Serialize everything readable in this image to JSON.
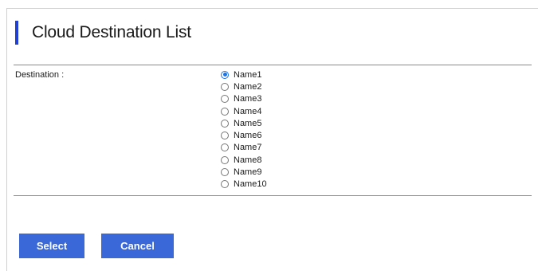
{
  "page": {
    "title": "Cloud Destination List",
    "accent_color": "#1f3fd6"
  },
  "form": {
    "destination_label": "Destination :",
    "selected_index": 0,
    "options": [
      {
        "label": "Name1",
        "checked": true
      },
      {
        "label": "Name2",
        "checked": false
      },
      {
        "label": "Name3",
        "checked": false
      },
      {
        "label": "Name4",
        "checked": false
      },
      {
        "label": "Name5",
        "checked": false
      },
      {
        "label": "Name6",
        "checked": false
      },
      {
        "label": "Name7",
        "checked": false
      },
      {
        "label": "Name8",
        "checked": false
      },
      {
        "label": "Name9",
        "checked": false
      },
      {
        "label": "Name10",
        "checked": false
      }
    ]
  },
  "actions": {
    "select_label": "Select",
    "cancel_label": "Cancel",
    "button_color": "#3a68d8"
  }
}
